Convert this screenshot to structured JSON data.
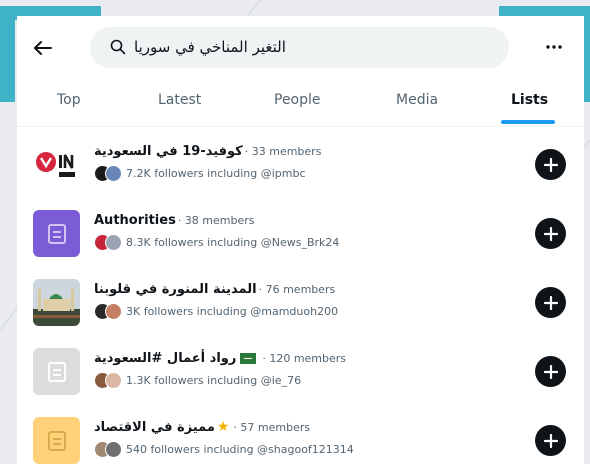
{
  "search": {
    "query": "التغير المناخي في سوريا"
  },
  "tabs": [
    {
      "label": "Top"
    },
    {
      "label": "Latest"
    },
    {
      "label": "People"
    },
    {
      "label": "Media"
    },
    {
      "label": "Lists"
    }
  ],
  "active_tab": "Lists",
  "lists": [
    {
      "title": "كوفيد-19 في السعودية",
      "members": "· 33 members",
      "followers": "7.2K followers including @ipmbc"
    },
    {
      "title": "Authorities",
      "members": "· 38 members",
      "followers": "8.3K followers including @News_Brk24"
    },
    {
      "title": "المدينة المنورة في قلوبنا",
      "members": "· 76 members",
      "followers": "3K followers including @mamduoh200"
    },
    {
      "title": "رواد أعمال #السعودية",
      "members": "· 120 members",
      "followers": "1.3K followers including @ie_76"
    },
    {
      "title": "مميزة في الاقتصاد",
      "members": "· 57 members",
      "followers": "540 followers including @shagoof121314"
    }
  ],
  "colors": {
    "accent": "#1d9bf0",
    "teal_frame": "#3fb2c8",
    "list_icon_purple": "#7b5bd6",
    "list_icon_gray": "#dcdcdc",
    "list_icon_yellow": "#ffd27a"
  }
}
